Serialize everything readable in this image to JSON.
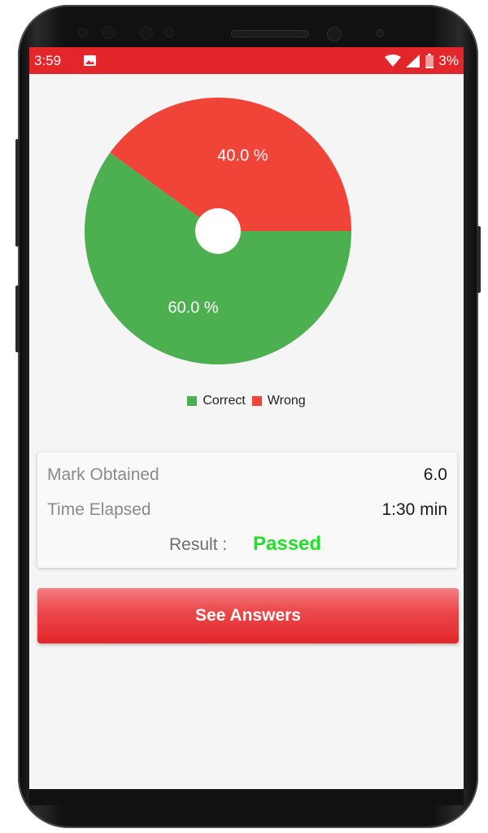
{
  "status_bar": {
    "time": "3:59",
    "battery_percent": "3%",
    "icons": [
      "image-icon",
      "wifi-icon",
      "signal-icon",
      "battery-icon"
    ]
  },
  "chart_data": {
    "type": "pie",
    "categories": [
      "Correct",
      "Wrong"
    ],
    "values": [
      60.0,
      40.0
    ],
    "labels": [
      "60.0 %",
      "40.0 %"
    ],
    "colors": [
      "#4caf50",
      "#f04438"
    ],
    "hole": true,
    "legend_position": "bottom"
  },
  "legend": {
    "correct_label": "Correct",
    "wrong_label": "Wrong"
  },
  "summary": {
    "mark_label": "Mark Obtained",
    "mark_value": "6.0",
    "time_label": "Time Elapsed",
    "time_value": "1:30 min",
    "result_label": "Result :",
    "result_value": "Passed"
  },
  "actions": {
    "see_answers_label": "See Answers"
  },
  "colors": {
    "accent": "#e32629",
    "passed": "#22e02a",
    "correct": "#4caf50",
    "wrong": "#f04438"
  }
}
